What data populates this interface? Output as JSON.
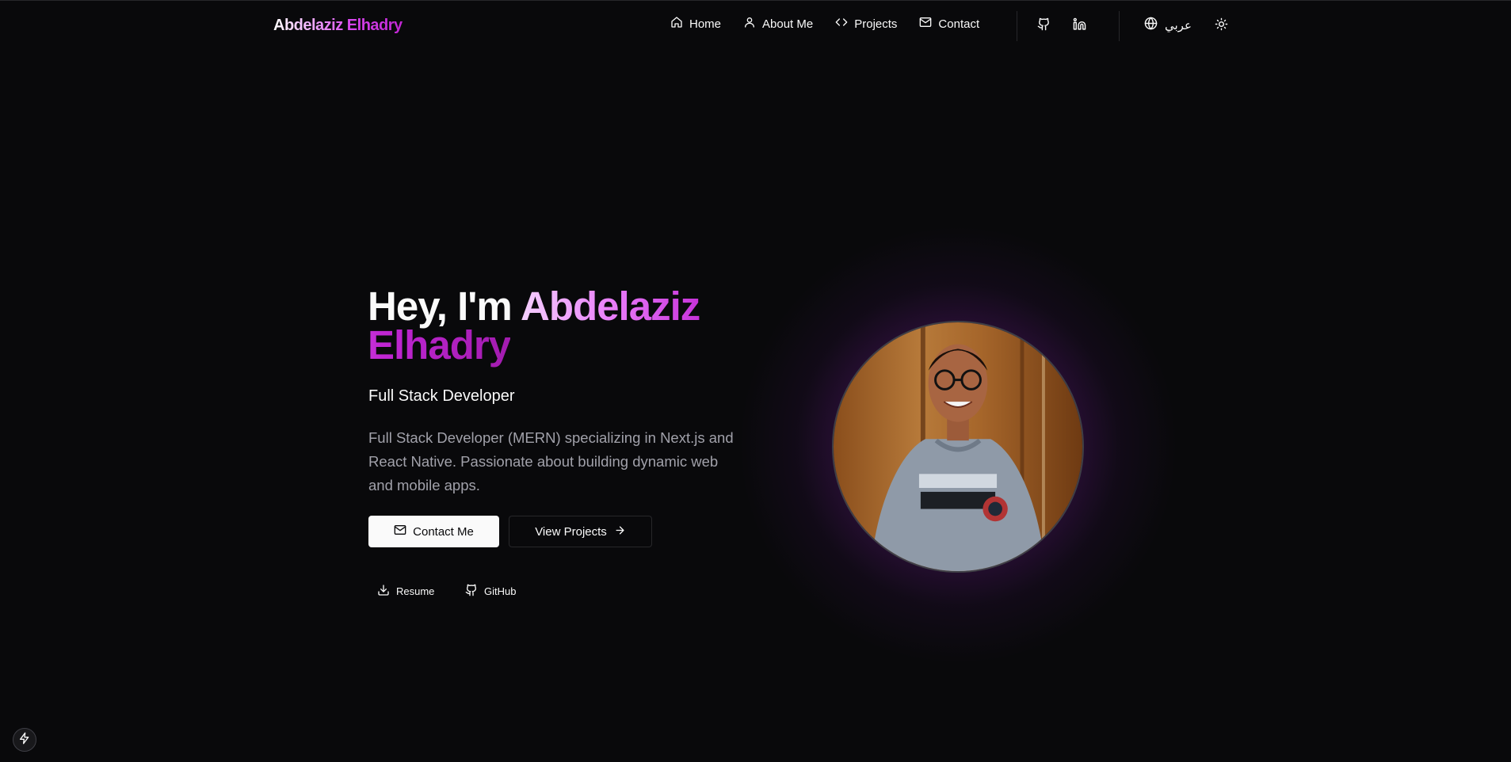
{
  "navbar": {
    "brand": "Abdelaziz Elhadry",
    "links": [
      {
        "label": "Home",
        "icon": "home-icon"
      },
      {
        "label": "About Me",
        "icon": "user-icon"
      },
      {
        "label": "Projects",
        "icon": "code-icon"
      },
      {
        "label": "Contact",
        "icon": "mail-icon"
      }
    ],
    "social_icons": [
      "github-icon",
      "linkedin-icon"
    ],
    "language_label": "عربي",
    "theme_icon": "sun-icon"
  },
  "hero": {
    "title_lead": "Hey, I'm ",
    "title_name": "Abdelaziz Elhadry",
    "subtitle": "Full Stack Developer",
    "description": "Full Stack Developer (MERN) specializing in Next.js and React Native. Passionate about building dynamic web and mobile apps.",
    "contact_label": "Contact Me",
    "projects_label": "View Projects",
    "resume_label": "Resume",
    "github_label": "GitHub"
  },
  "colors": {
    "background": "#09090b",
    "accent": "#c026d3",
    "accent_light": "#f0abfc",
    "muted_text": "#a1a1aa",
    "border": "#27272a"
  }
}
